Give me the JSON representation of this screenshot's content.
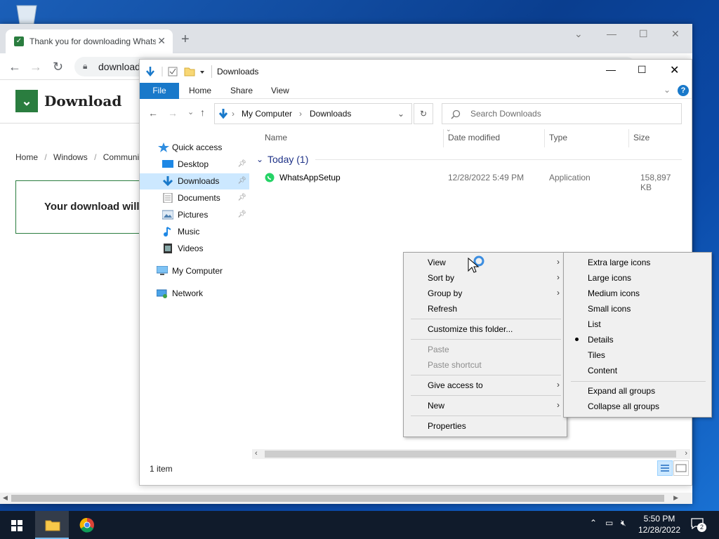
{
  "chrome": {
    "tab_title": "Thank you for downloading WhatsApp",
    "new_tab": "+",
    "url": "download"
  },
  "site": {
    "logo_text": "Download",
    "breadcrumb": [
      "Home",
      "/",
      "Windows",
      "/",
      "Communic"
    ],
    "download_box_text": "Your download will"
  },
  "explorer": {
    "title": "Downloads",
    "ribbon_tabs": [
      "File",
      "Home",
      "Share",
      "View"
    ],
    "address": [
      "My Computer",
      "Downloads"
    ],
    "search_placeholder": "Search Downloads",
    "nav": [
      {
        "label": "Quick access"
      },
      {
        "label": "Desktop"
      },
      {
        "label": "Downloads"
      },
      {
        "label": "Documents"
      },
      {
        "label": "Pictures"
      },
      {
        "label": "Music"
      },
      {
        "label": "Videos"
      },
      {
        "label": "My Computer"
      },
      {
        "label": "Network"
      }
    ],
    "columns": [
      "Name",
      "Date modified",
      "Type",
      "Size"
    ],
    "group": "Today (1)",
    "file": {
      "name": "WhatsAppSetup",
      "date": "12/28/2022 5:49 PM",
      "type": "Application",
      "size": "158,897 KB"
    },
    "status": "1 item"
  },
  "context_menu": {
    "view": "View",
    "sort_by": "Sort by",
    "group_by": "Group by",
    "refresh": "Refresh",
    "customize": "Customize this folder...",
    "paste": "Paste",
    "paste_shortcut": "Paste shortcut",
    "give_access": "Give access to",
    "new": "New",
    "properties": "Properties"
  },
  "view_submenu": {
    "extra_large": "Extra large icons",
    "large": "Large icons",
    "medium": "Medium icons",
    "small": "Small icons",
    "list": "List",
    "details": "Details",
    "tiles": "Tiles",
    "content": "Content",
    "expand": "Expand all groups",
    "collapse": "Collapse all groups",
    "selected": "Details"
  },
  "taskbar": {
    "time": "5:50 PM",
    "date": "12/28/2022",
    "notifications": "2"
  },
  "colors": {
    "accent": "#1979ca",
    "site_green": "#2a7d3f",
    "taskbar": "#101b2b"
  }
}
